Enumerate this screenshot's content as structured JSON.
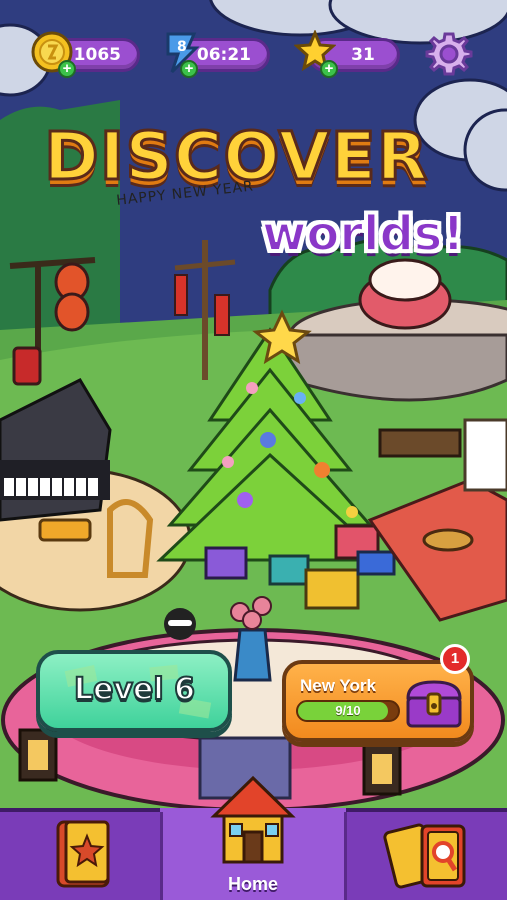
{
  "hud": {
    "coins": "1065",
    "timer": "06:21",
    "timer_badge": "8",
    "stars": "31",
    "coin_icon": "coin-icon",
    "energy_icon": "energy-bolt-icon",
    "star_icon": "star-icon",
    "settings_icon": "gear-icon"
  },
  "promo": {
    "title": "DISCOVER",
    "subtitle": "worlds!",
    "banner": "HAPPY NEW YEAR"
  },
  "level_button": {
    "label": "Level 6"
  },
  "location": {
    "name": "New York",
    "progress_text": "9/10",
    "progress_fraction": 0.9,
    "notification_count": "1"
  },
  "nav": {
    "home_label": "Home",
    "left_icon": "star-book-icon",
    "center_icon": "house-icon",
    "right_icon": "cards-magnifier-icon"
  },
  "colors": {
    "hud_pill": "#9b4fd0",
    "nav_bar": "#7a3cb8",
    "title_yellow": "#ffd23a",
    "title_purple": "#8a37c8",
    "level_green": "#3fd29b",
    "location_orange": "#f28a1e"
  }
}
